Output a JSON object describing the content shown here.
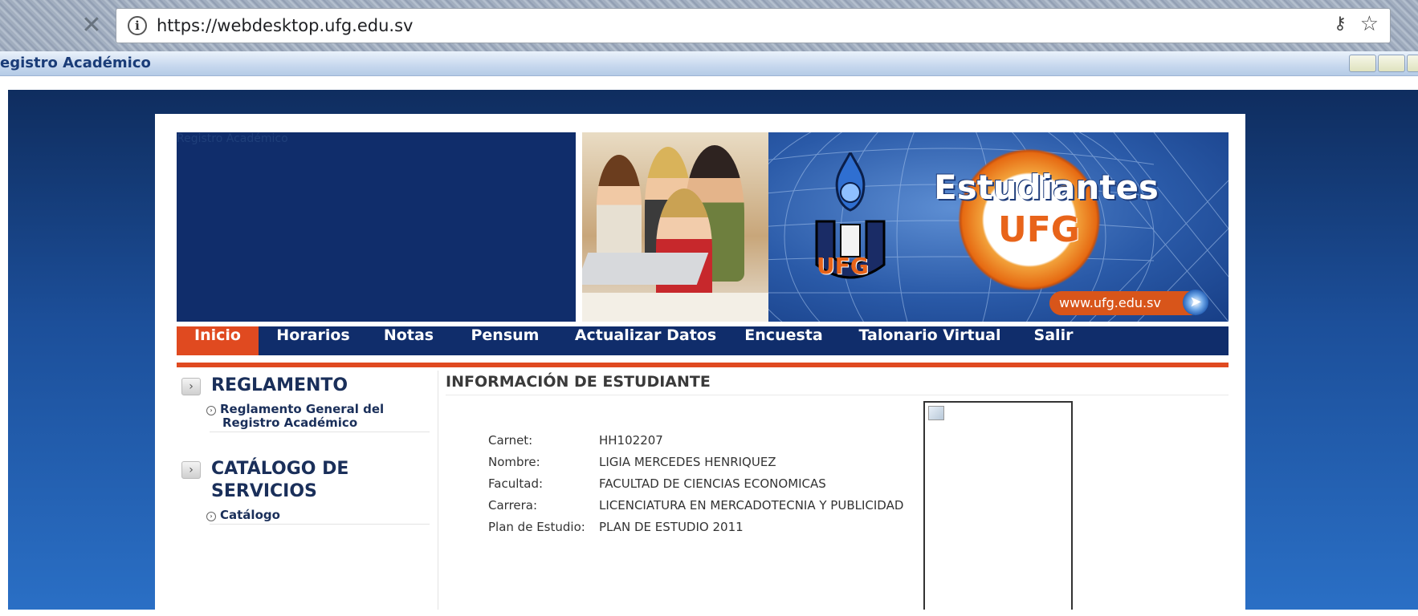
{
  "browser": {
    "url": "https://webdesktop.ufg.edu.sv"
  },
  "window": {
    "title": "egistro Académico"
  },
  "banner": {
    "left_text": "Registro Académico",
    "brand_word": "Estudiantes",
    "brand_sub": "UFG",
    "logo_text": "UFG",
    "site": "www.ufg.edu.sv"
  },
  "nav": {
    "items": [
      {
        "label": "Inicio",
        "active": true
      },
      {
        "label": "Horarios",
        "active": false
      },
      {
        "label": "Notas",
        "active": false
      },
      {
        "label": "Pensum",
        "active": false
      },
      {
        "label": "Actualizar Datos",
        "active": false
      },
      {
        "label": "Encuesta",
        "active": false
      },
      {
        "label": "Talonario Virtual",
        "active": false
      },
      {
        "label": "Salir",
        "active": false
      }
    ]
  },
  "sidebar": {
    "sections": [
      {
        "heading": "REGLAMENTO",
        "links": [
          {
            "line1": "Reglamento General del",
            "line2": "Registro Académico"
          }
        ]
      },
      {
        "heading_line1": "CATÁLOGO DE",
        "heading_line2": "SERVICIOS",
        "links": [
          {
            "label": "Catálogo"
          }
        ]
      }
    ]
  },
  "student": {
    "title": "INFORMACIÓN DE ESTUDIANTE",
    "fields": [
      {
        "label": "Carnet:",
        "value": "HH102207"
      },
      {
        "label": "Nombre:",
        "value": "LIGIA MERCEDES HENRIQUEZ"
      },
      {
        "label": "Facultad:",
        "value": "FACULTAD DE CIENCIAS ECONOMICAS"
      },
      {
        "label": "Carrera:",
        "value": "LICENCIATURA EN MERCADOTECNIA Y PUBLICIDAD"
      },
      {
        "label": "Plan de Estudio:",
        "value": "PLAN DE ESTUDIO 2011"
      }
    ]
  },
  "colors": {
    "nav_bg": "#102d6b",
    "accent": "#e04a20",
    "page_bg": "#1c4f9a"
  },
  "icons": {
    "back": "close-icon",
    "info": "info-icon",
    "key": "key-icon",
    "star": "star-icon",
    "pointer": "pointer-icon"
  }
}
